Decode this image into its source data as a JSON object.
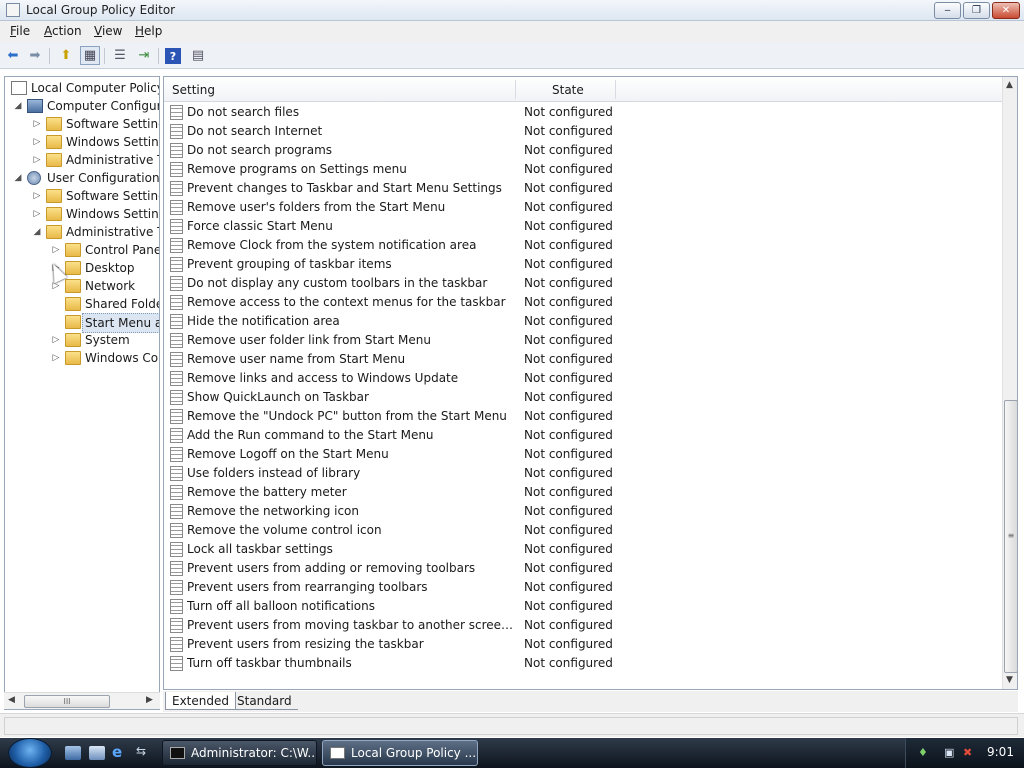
{
  "window": {
    "title": "Local Group Policy Editor",
    "controls": {
      "minimize": "‒",
      "maximize": "❐",
      "close": "✕"
    }
  },
  "menu": [
    "File",
    "Action",
    "View",
    "Help"
  ],
  "toolbar": {
    "icons": [
      "back-icon",
      "forward-icon",
      "up-icon",
      "show-hide-tree-icon",
      "list-icon",
      "export-icon",
      "help-icon",
      "properties-icon"
    ],
    "glyphs": {
      "back": "⬅",
      "forward": "➡",
      "up": "⬆",
      "showhide": "▦",
      "list": "☰",
      "export": "⇥",
      "help": "?",
      "props": "▤"
    }
  },
  "tree": {
    "items": [
      {
        "label": "Local Computer Policy",
        "icon": "policy",
        "expander": ""
      },
      {
        "label": "Computer Configura",
        "icon": "computer",
        "expander": "◢"
      },
      {
        "label": "Software Settings",
        "icon": "folder",
        "expander": "▷"
      },
      {
        "label": "Windows Setting",
        "icon": "folder",
        "expander": "▷"
      },
      {
        "label": "Administrative Te",
        "icon": "folder",
        "expander": "▷"
      },
      {
        "label": "User Configuration",
        "icon": "user",
        "expander": "◢"
      },
      {
        "label": "Software Settings",
        "icon": "folder",
        "expander": "▷"
      },
      {
        "label": "Windows Setting",
        "icon": "folder",
        "expander": "▷"
      },
      {
        "label": "Administrative Te",
        "icon": "folder",
        "expander": "◢"
      },
      {
        "label": "Control Panel",
        "icon": "folder",
        "expander": "▷"
      },
      {
        "label": "Desktop",
        "icon": "folder",
        "expander": "▷"
      },
      {
        "label": "Network",
        "icon": "folder",
        "expander": "▷"
      },
      {
        "label": "Shared Folder",
        "icon": "folder",
        "expander": ""
      },
      {
        "label": "Start Menu ar",
        "icon": "folder",
        "expander": "",
        "selected": true
      },
      {
        "label": "System",
        "icon": "folder",
        "expander": "▷"
      },
      {
        "label": "Windows Cor",
        "icon": "folder",
        "expander": "▷"
      }
    ],
    "scroll": {
      "left": "◀",
      "right": "▶",
      "thumb": "III"
    }
  },
  "list": {
    "columns": {
      "setting": "Setting",
      "state": "State"
    },
    "rows": [
      {
        "setting": "Do not search files",
        "state": "Not configured"
      },
      {
        "setting": "Do not search Internet",
        "state": "Not configured"
      },
      {
        "setting": "Do not search programs",
        "state": "Not configured"
      },
      {
        "setting": "Remove programs on Settings menu",
        "state": "Not configured"
      },
      {
        "setting": "Prevent changes to Taskbar and Start Menu Settings",
        "state": "Not configured"
      },
      {
        "setting": "Remove user's folders from the Start Menu",
        "state": "Not configured"
      },
      {
        "setting": "Force classic Start Menu",
        "state": "Not configured"
      },
      {
        "setting": "Remove Clock from the system notification area",
        "state": "Not configured"
      },
      {
        "setting": "Prevent grouping of taskbar items",
        "state": "Not configured"
      },
      {
        "setting": "Do not display any custom toolbars in the taskbar",
        "state": "Not configured"
      },
      {
        "setting": "Remove access to the context menus for the taskbar",
        "state": "Not configured"
      },
      {
        "setting": "Hide the notification area",
        "state": "Not configured"
      },
      {
        "setting": "Remove user folder link from Start Menu",
        "state": "Not configured"
      },
      {
        "setting": "Remove user name from Start Menu",
        "state": "Not configured"
      },
      {
        "setting": "Remove links and access to Windows Update",
        "state": "Not configured"
      },
      {
        "setting": "Show QuickLaunch on Taskbar",
        "state": "Not configured"
      },
      {
        "setting": "Remove the \"Undock PC\" button from the Start Menu",
        "state": "Not configured"
      },
      {
        "setting": "Add the Run command to the Start Menu",
        "state": "Not configured"
      },
      {
        "setting": "Remove Logoff on the Start Menu",
        "state": "Not configured"
      },
      {
        "setting": "Use folders instead of library",
        "state": "Not configured"
      },
      {
        "setting": "Remove the battery meter",
        "state": "Not configured"
      },
      {
        "setting": "Remove the networking icon",
        "state": "Not configured"
      },
      {
        "setting": "Remove the volume control icon",
        "state": "Not configured"
      },
      {
        "setting": "Lock all taskbar settings",
        "state": "Not configured"
      },
      {
        "setting": "Prevent users from adding or removing toolbars",
        "state": "Not configured"
      },
      {
        "setting": "Prevent users from rearranging toolbars",
        "state": "Not configured"
      },
      {
        "setting": "Turn off all balloon notifications",
        "state": "Not configured"
      },
      {
        "setting": "Prevent users from moving taskbar to another screen dock l...",
        "state": "Not configured"
      },
      {
        "setting": "Prevent users from resizing the taskbar",
        "state": "Not configured"
      },
      {
        "setting": "Turn off taskbar thumbnails",
        "state": "Not configured"
      }
    ],
    "scroll": {
      "up": "▲",
      "down": "▼",
      "grip": "≡"
    }
  },
  "tabs": [
    "Extended",
    "Standard"
  ],
  "taskbar": {
    "tasks": [
      {
        "label": "Administrator: C:\\W...",
        "icon": "command-prompt-icon"
      },
      {
        "label": "Local Group Policy ...",
        "icon": "policy-editor-icon",
        "active": true
      }
    ],
    "quick_launch": [
      "show-desktop-icon",
      "explorer-icon",
      "internet-explorer-icon",
      "switch-windows-icon"
    ],
    "ql_glyphs": {
      "ie": "e",
      "switch": "⇆"
    },
    "tray": {
      "icons": [
        "windows-defender-icon",
        "network-icon",
        "volume-muted-icon"
      ],
      "glyphs": [
        "♦",
        "▣",
        "✖"
      ],
      "clock": "9:01"
    }
  }
}
